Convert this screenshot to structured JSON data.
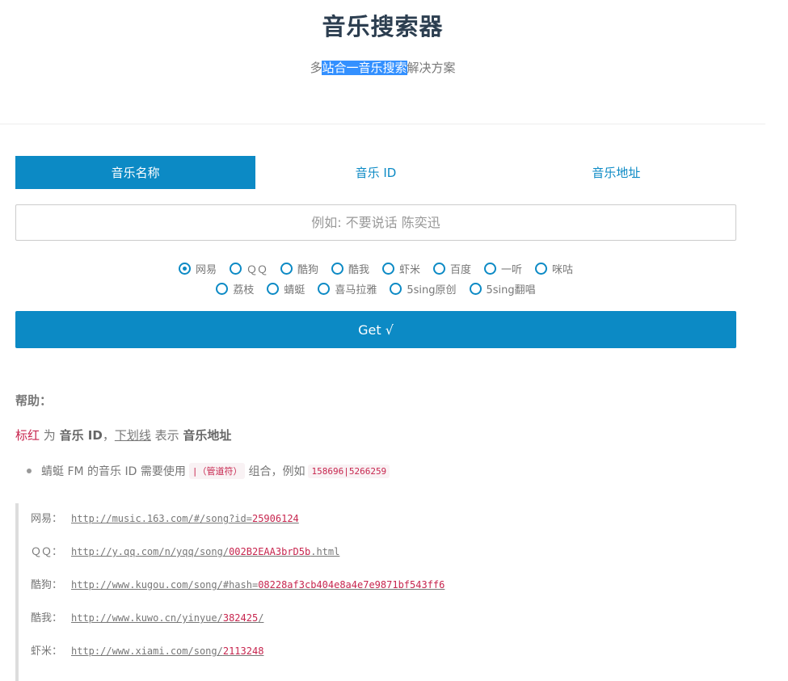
{
  "header": {
    "title": "音乐搜索器",
    "subtitle_pre": "多",
    "subtitle_highlight": "站合一音乐搜索",
    "subtitle_post": "解决方案"
  },
  "tabs": [
    {
      "label": "音乐名称",
      "active": true
    },
    {
      "label": "音乐 ID",
      "active": false
    },
    {
      "label": "音乐地址",
      "active": false
    }
  ],
  "search": {
    "placeholder": "例如: 不要说话 陈奕迅",
    "value": ""
  },
  "sources": {
    "row1": [
      {
        "label": "网易",
        "checked": true
      },
      {
        "label": "ＱＱ",
        "checked": false
      },
      {
        "label": "酷狗",
        "checked": false
      },
      {
        "label": "酷我",
        "checked": false
      },
      {
        "label": "虾米",
        "checked": false
      },
      {
        "label": "百度",
        "checked": false
      },
      {
        "label": "一听",
        "checked": false
      },
      {
        "label": "咪咕",
        "checked": false
      }
    ],
    "row2": [
      {
        "label": "荔枝",
        "checked": false
      },
      {
        "label": "蜻蜓",
        "checked": false
      },
      {
        "label": "喜马拉雅",
        "checked": false
      },
      {
        "label": "5sing原创",
        "checked": false
      },
      {
        "label": "5sing翻唱",
        "checked": false
      }
    ]
  },
  "get_button": "Get √",
  "help": {
    "title": "帮助：",
    "legend": {
      "red": "标红",
      "t1": " 为 ",
      "b1": "音乐 ID",
      "t2": "，",
      "underline": "下划线",
      "t3": " 表示 ",
      "b2": "音乐地址"
    },
    "bullet": {
      "text1": "蜻蜓 FM 的音乐 ID 需要使用",
      "code1": "|（管道符）",
      "text2": "组合，例如",
      "code2": "158696|5266259"
    },
    "examples": [
      {
        "label": "网易：",
        "url": "http://music.163.com/#/song?id=",
        "id": "25906124"
      },
      {
        "label": "ＱＱ：",
        "url": "http://y.qq.com/n/yqq/song/",
        "id": "002B2EAA3brD5b",
        "suffix": ".html"
      },
      {
        "label": "酷狗：",
        "url": "http://www.kugou.com/song/#hash=",
        "id": "08228af3cb404e8a4e7e9871bf543ff6"
      },
      {
        "label": "酷我：",
        "url": "http://www.kuwo.cn/yinyue/",
        "id": "382425",
        "suffix": "/"
      },
      {
        "label": "虾米：",
        "url": "http://www.xiami.com/song/",
        "id": "2113248"
      }
    ]
  },
  "colors": {
    "accent": "#0c8ac5",
    "highlight": "#3390ff",
    "id_red": "#c7254e"
  }
}
